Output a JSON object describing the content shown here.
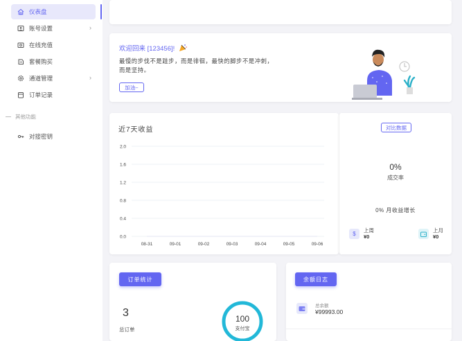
{
  "sidebar": {
    "items": [
      {
        "label": "仪表盘",
        "icon": "home-icon",
        "active": true
      },
      {
        "label": "账号设置",
        "icon": "user-card-icon",
        "has_children": true
      },
      {
        "label": "在线充值",
        "icon": "recharge-icon"
      },
      {
        "label": "套餐购买",
        "icon": "package-icon"
      },
      {
        "label": "通道管理",
        "icon": "gear-icon",
        "has_children": true
      },
      {
        "label": "订单记录",
        "icon": "order-icon"
      }
    ],
    "section_label": "其他功能",
    "extra_items": [
      {
        "label": "对接密钥",
        "icon": "key-icon"
      }
    ]
  },
  "welcome": {
    "title": "欢迎回来 [123456]!",
    "line1": "最慢的步伐不是跬步，而是徘徊，最快的脚步不是冲刺，",
    "line2": "而是坚持。",
    "button": "加油~"
  },
  "chart_card": {
    "title": "近7天收益"
  },
  "chart_data": {
    "type": "line",
    "title": "近7天收益",
    "categories": [
      "08-31",
      "09-01",
      "09-02",
      "09-03",
      "09-04",
      "09-05",
      "09-06"
    ],
    "series": [
      {
        "values": [
          0,
          0,
          0,
          0,
          0,
          0,
          0
        ]
      }
    ],
    "ylim": [
      0,
      2.0
    ],
    "yticks": [
      "0.0",
      "0.4",
      "0.8",
      "1.2",
      "1.6",
      "2.0"
    ],
    "grid": true
  },
  "compare": {
    "button": "对比数据",
    "rate_value": "0%",
    "rate_label": "成交率",
    "growth": "0% 月收益增长",
    "last_week_label": "上周",
    "last_week_value": "¥0",
    "last_month_label": "上月",
    "last_month_value": "¥0"
  },
  "orders": {
    "button": "订单统计",
    "total": "3",
    "total_label": "总订单",
    "ring_value": "100",
    "ring_label": "支付宝"
  },
  "balance": {
    "button": "余额日志",
    "label": "总余额",
    "value": "¥99993.00"
  },
  "colors": {
    "accent": "#6366f1",
    "ring": "#22b8d8",
    "background": "#f3f3f7"
  }
}
